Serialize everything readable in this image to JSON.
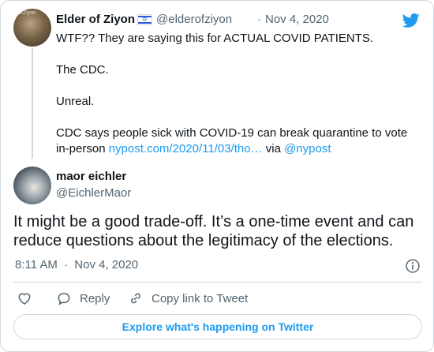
{
  "colors": {
    "link": "#1d9bf0",
    "text": "#0f1419",
    "muted": "#536471",
    "border": "#cfd9de"
  },
  "quoted_tweet": {
    "author_name": "Elder of Ziyon",
    "flag_icon": "israel-flag-icon",
    "handle": "@elderofziyon",
    "separator": "·",
    "date": "Nov 4, 2020",
    "avatar_watermark": "ofZiyon",
    "lines": [
      "WTF?? They are saying this for ACTUAL COVID PATIENTS.",
      "The CDC.",
      "Unreal.",
      "CDC says people sick with COVID-19 can break quarantine to vote"
    ],
    "last_line_prefix": "in-person ",
    "link_text": "nypost.com/2020/11/03/tho…",
    "via_text": " via ",
    "mention": "@nypost"
  },
  "reply_tweet": {
    "author_name": "maor eichler",
    "handle": "@EichlerMaor",
    "text": "It might be a good trade-off. It’s a one-time event and can reduce questions about the legitimacy of the elections.",
    "time": "8:11 AM",
    "separator": "·",
    "date": "Nov 4, 2020"
  },
  "actions": {
    "reply_label": "Reply",
    "copy_link_label": "Copy link to Tweet"
  },
  "explore_label": "Explore what's happening on Twitter",
  "icons": [
    "twitter-bird-icon",
    "heart-icon",
    "reply-icon",
    "link-icon",
    "info-icon"
  ]
}
